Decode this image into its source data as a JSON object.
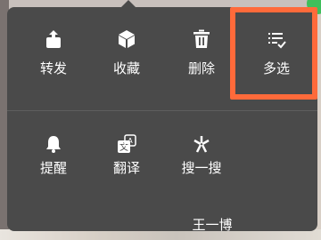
{
  "menu": {
    "row1": [
      {
        "label": "转发",
        "icon": "share-icon"
      },
      {
        "label": "收藏",
        "icon": "cube-icon"
      },
      {
        "label": "删除",
        "icon": "trash-icon"
      },
      {
        "label": "多选",
        "icon": "multi-select-icon"
      }
    ],
    "row2": [
      {
        "label": "提醒",
        "icon": "bell-icon"
      },
      {
        "label": "翻译",
        "icon": "translate-icon"
      },
      {
        "label": "搜一搜",
        "icon": "sparkle-icon"
      }
    ],
    "search_query": "王一博"
  },
  "colors": {
    "popup_bg": "#4a4a4a",
    "highlight": "#ff6a3a",
    "text": "#ffffff"
  }
}
